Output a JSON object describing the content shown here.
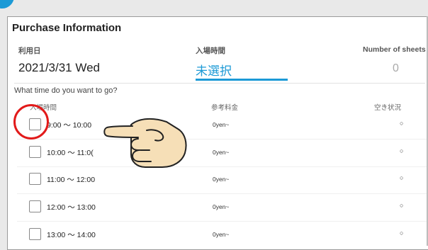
{
  "header": {
    "title": "Purchase Information"
  },
  "fields": {
    "date_label": "利用日",
    "date_value": "2021/3/31 Wed",
    "time_label": "入場時間",
    "time_value": "未選択",
    "sheets_label": "Number of sheets",
    "sheets_value": "0"
  },
  "question": "What time do you want to go?",
  "table": {
    "headers": [
      "入場時間",
      "参考料金",
      "空き状況"
    ],
    "rows": [
      {
        "time": "9:00 ～ 10:00",
        "price": "0yen~",
        "avail": "○"
      },
      {
        "time": "10:00 ～ 11:0(",
        "price": "0yen~",
        "avail": "○"
      },
      {
        "time": "11:00 ～ 12:00",
        "price": "0yen~",
        "avail": "○"
      },
      {
        "time": "12:00 ～ 13:00",
        "price": "0yen~",
        "avail": "○"
      },
      {
        "time": "13:00 ～ 14:00",
        "price": "0yen~",
        "avail": "○"
      }
    ]
  },
  "colors": {
    "accent": "#1c9ad6",
    "highlight_circle": "#e21a1a",
    "hand_skin": "#f6dfb7"
  },
  "icons": [
    "pointing-hand-icon",
    "highlight-circle"
  ]
}
